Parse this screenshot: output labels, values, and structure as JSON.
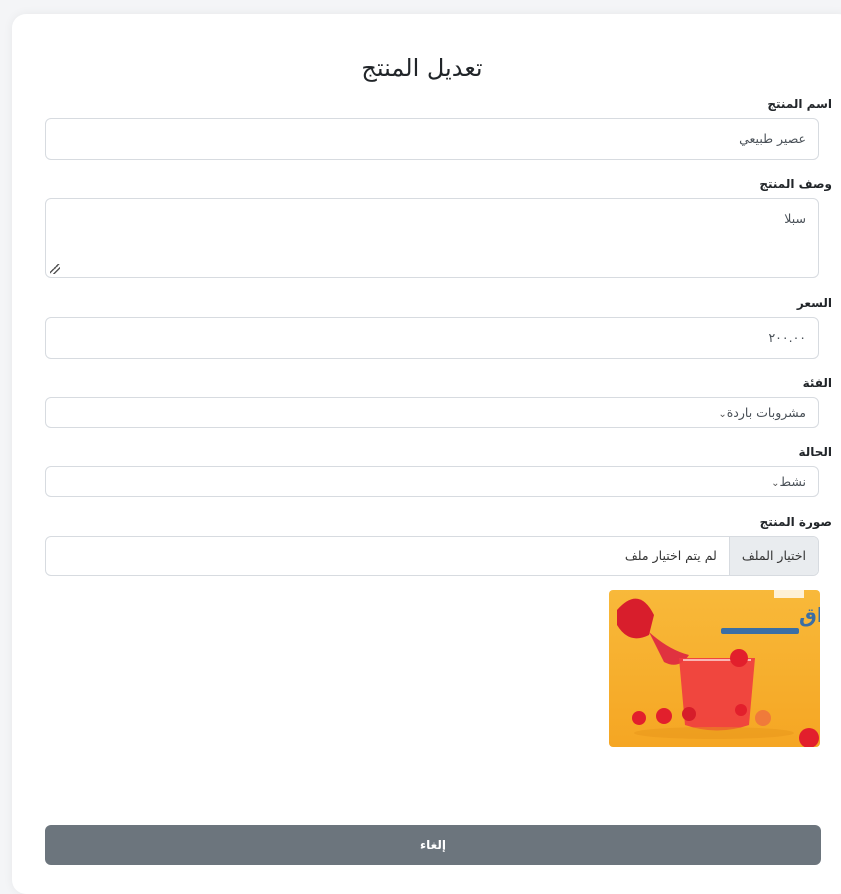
{
  "form": {
    "title": "تعديل المنتج",
    "name": {
      "label": "اسم المنتج",
      "value": "عصير طبيعي"
    },
    "description": {
      "label": "وصف المنتج",
      "value": "سبلا"
    },
    "price": {
      "label": "السعر",
      "value": "٢٠٠.٠٠"
    },
    "category": {
      "label": "الفئة",
      "selected": "مشروبات باردة"
    },
    "status": {
      "label": "الحالة",
      "selected": "نشط"
    },
    "image": {
      "label": "صورة المنتج",
      "button": "اختيار الملف",
      "file_name": "لم يتم اختيار ملف",
      "preview_text": "مـذاق"
    },
    "cancel_button": "إلغاء"
  },
  "colors": {
    "cancel_bg": "#6c757d",
    "preview_bg": "#f5a623"
  }
}
